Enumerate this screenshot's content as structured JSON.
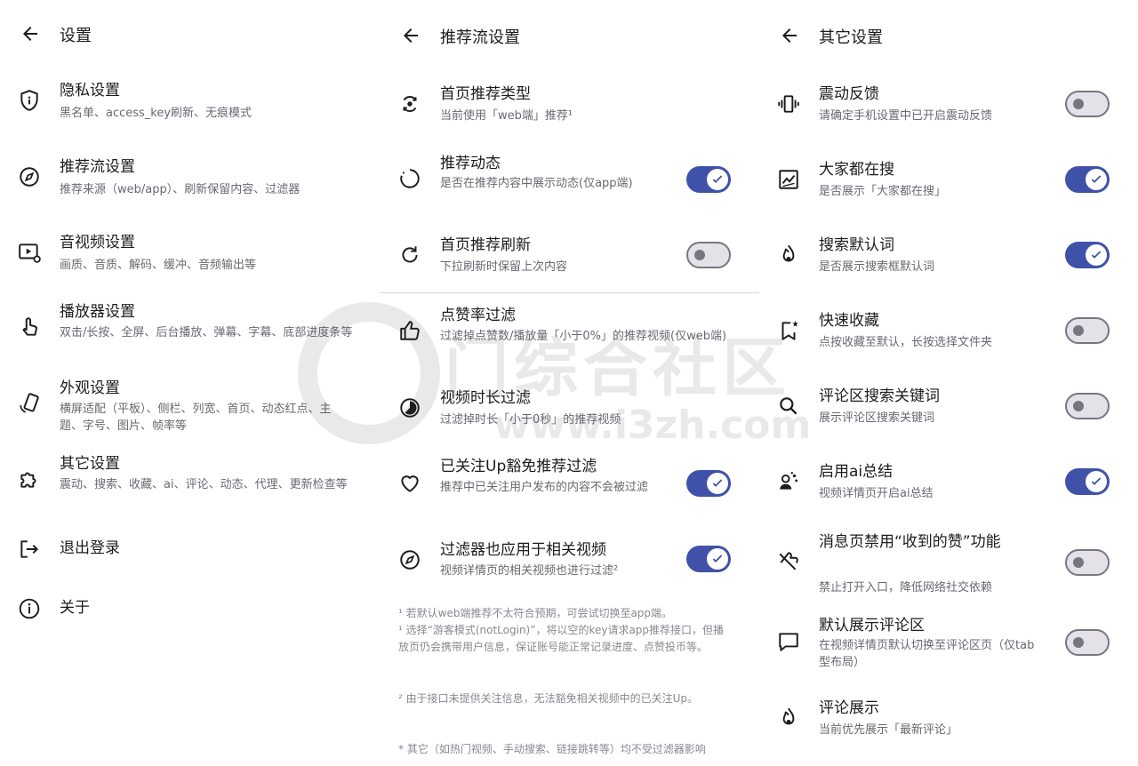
{
  "panel1": {
    "title": "设置",
    "items": [
      {
        "title": "隐私设置",
        "sub": "黑名单、access_key刷新、无痕模式"
      },
      {
        "title": "推荐流设置",
        "sub": "推荐来源（web/app）、刷新保留内容、过滤器"
      },
      {
        "title": "音视频设置",
        "sub": "画质、音质、解码、缓冲、音频输出等"
      },
      {
        "title": "播放器设置",
        "sub": "双击/长按、全屏、后台播放、弹幕、字幕、底部进度条等"
      },
      {
        "title": "外观设置",
        "sub": "横屏适配（平板）、侧栏、列宽、首页、动态红点、主题、字号、图片、帧率等"
      },
      {
        "title": "其它设置",
        "sub": "震动、搜索、收藏、ai、评论、动态、代理、更新检查等"
      },
      {
        "title": "退出登录",
        "sub": ""
      },
      {
        "title": "关于",
        "sub": ""
      }
    ]
  },
  "panel2": {
    "title": "推荐流设置",
    "items": [
      {
        "title": "首页推荐类型",
        "sub": "当前使用「web端」推荐¹"
      },
      {
        "title": "推荐动态",
        "sub": "是否在推荐内容中展示动态(仅app端)"
      },
      {
        "title": "首页推荐刷新",
        "sub": "下拉刷新时保留上次内容"
      },
      {
        "title": "点赞率过滤",
        "sub": "过滤掉点赞数/播放量「小于0%」的推荐视频(仅web端)"
      },
      {
        "title": "视频时长过滤",
        "sub": "过滤掉时长「小于0秒」的推荐视频"
      },
      {
        "title": "已关注Up豁免推荐过滤",
        "sub": "推荐中已关注用户发布的内容不会被过滤"
      },
      {
        "title": "过滤器也应用于相关视频",
        "sub": "视频详情页的相关视频也进行过滤²"
      }
    ],
    "notes": [
      "¹ 若默认web端推荐不太符合预期，可尝试切换至app端。",
      "¹ 选择“游客模式(notLogin)”，将以空的key请求app推荐接口，但播放页仍会携带用户信息，保证账号能正常记录进度、点赞投币等。",
      "² 由于接口未提供关注信息，无法豁免相关视频中的已关注Up。",
      "* 其它（如热门视频、手动搜索、链接跳转等）均不受过滤器影响"
    ]
  },
  "panel3": {
    "title": "其它设置",
    "items": [
      {
        "title": "震动反馈",
        "sub": "请确定手机设置中已开启震动反馈"
      },
      {
        "title": "大家都在搜",
        "sub": "是否展示「大家都在搜」"
      },
      {
        "title": "搜索默认词",
        "sub": "是否展示搜索框默认词"
      },
      {
        "title": "快速收藏",
        "sub": "点按收藏至默认，长按选择文件夹"
      },
      {
        "title": "评论区搜索关键词",
        "sub": "展示评论区搜索关键词"
      },
      {
        "title": "启用ai总结",
        "sub": "视频详情页开启ai总结"
      },
      {
        "title": "消息页禁用“收到的赞”功能",
        "sub": "禁止打开入口，降低网络社交依赖"
      },
      {
        "title": "默认展示评论区",
        "sub": "在视频详情页默认切换至评论区页（仅tab型布局）"
      },
      {
        "title": "评论展示",
        "sub": "当前优先展示「最新评论」"
      }
    ]
  },
  "watermark": {
    "text": "门综合社区",
    "url": "www.i3zh.com"
  },
  "colors": {
    "accent": "#3f51a8",
    "off_track": "#e5e1e9",
    "off_knob": "#777680"
  }
}
